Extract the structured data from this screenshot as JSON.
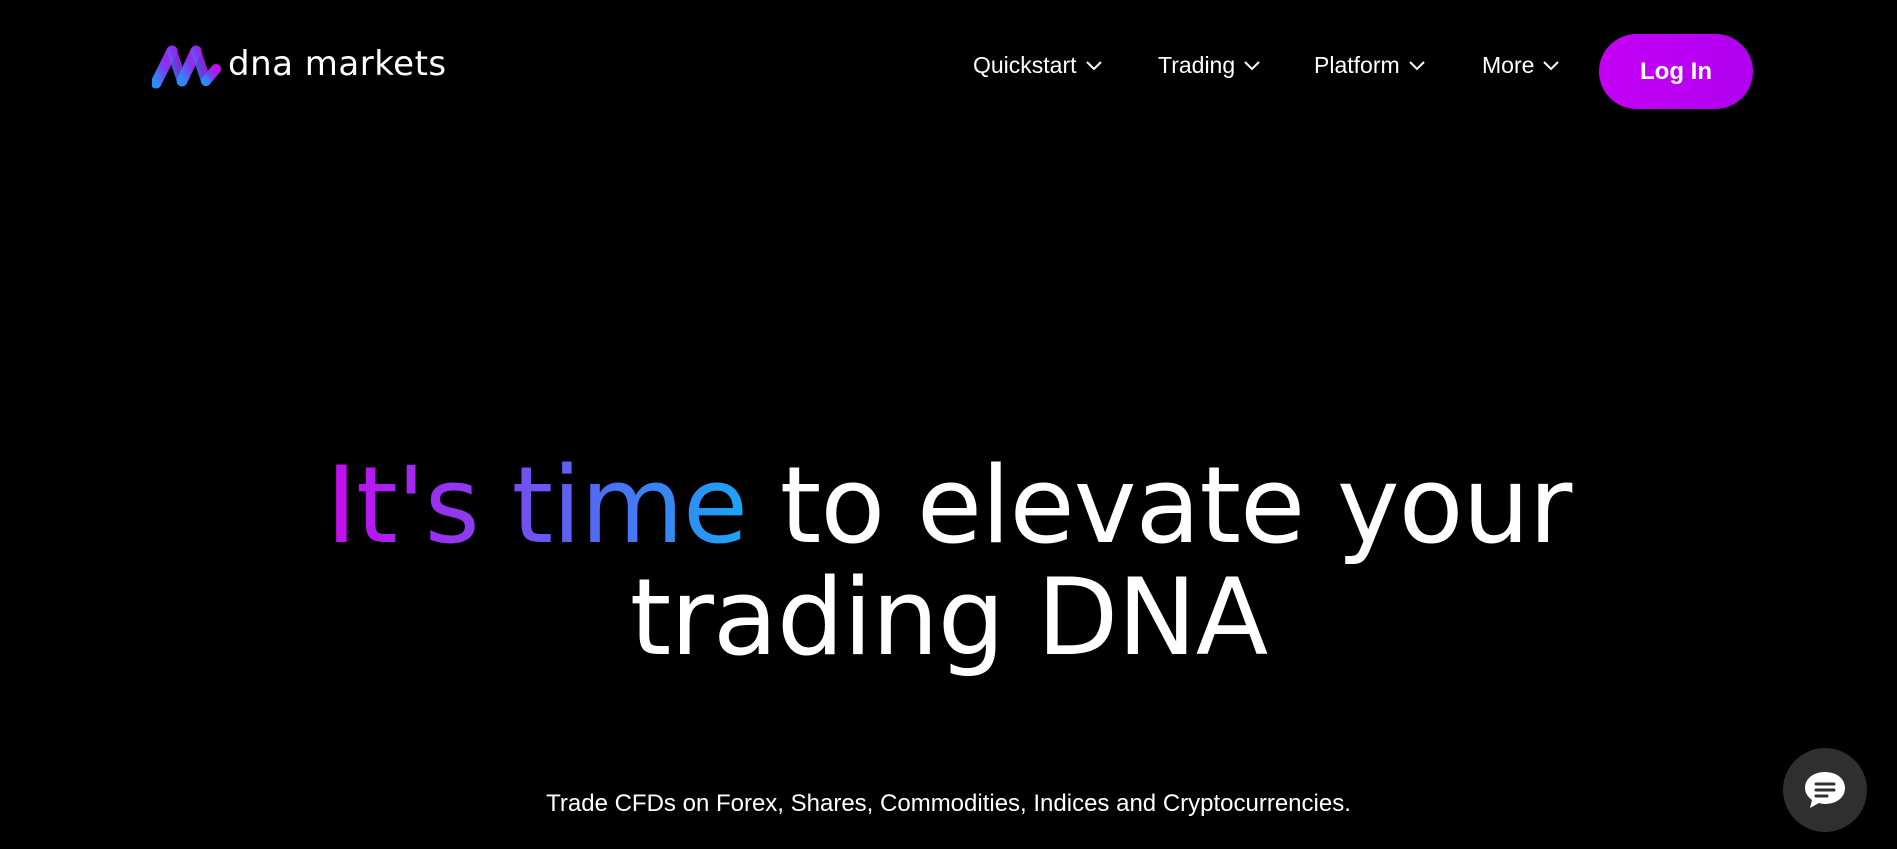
{
  "header": {
    "brand": "dna markets",
    "nav": [
      {
        "label": "Quickstart"
      },
      {
        "label": "Trading"
      },
      {
        "label": "Platform"
      },
      {
        "label": "More"
      }
    ],
    "login_label": "Log In"
  },
  "hero": {
    "headline_highlight": "It's time",
    "headline_rest": " to elevate your",
    "headline_line2": "trading DNA",
    "subtitle": "Trade CFDs on Forex, Shares, Commodities, Indices and Cryptocurrencies."
  },
  "icons": {
    "logo": "dna-logo-icon",
    "nav_chevron": "chevron-down-icon",
    "chat": "chat-bubble-icon"
  },
  "colors": {
    "background": "#000000",
    "accent": "#c400f5",
    "gradient_start": "#c80af0",
    "gradient_end": "#1aa6f5",
    "chat_button": "#2f2f2f"
  }
}
